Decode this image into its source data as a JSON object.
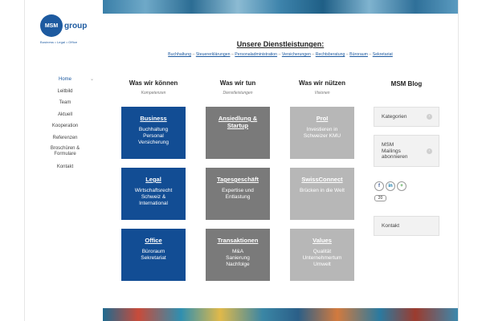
{
  "logo": {
    "mark": "MSM",
    "word": "group",
    "tagline": "Business • Legal • Office"
  },
  "nav": [
    {
      "label": "Home",
      "active": true
    },
    {
      "label": "Leitbild"
    },
    {
      "label": "Team"
    },
    {
      "label": "Aktuell"
    },
    {
      "label": "Kooperation"
    },
    {
      "label": "Referenzen"
    },
    {
      "label": "Broschüren & Formulare"
    },
    {
      "label": "Kontakt"
    }
  ],
  "services": {
    "title": "Unsere Dienstleistungen:",
    "links": [
      "Buchhaltung",
      "Steuererklärungen",
      "Personaladministration",
      "Versicherungen",
      "Rechtsberatung",
      "Büroraum",
      "Sekretariat"
    ],
    "separator": "–"
  },
  "columns": [
    {
      "title": "Was wir können",
      "subtitle": "Kompetenzen",
      "tiles": [
        {
          "title": "Business",
          "text": "Buchhaltung\nPersonal\nVersicherung",
          "style": "blue"
        },
        {
          "title": "Legal",
          "text": "Wirtschaftsrecht\nSchweiz &\nInternational",
          "style": "blue"
        },
        {
          "title": "Office",
          "text": "Büroraum\nSekretariat",
          "style": "blue"
        }
      ]
    },
    {
      "title": "Was wir tun",
      "subtitle": "Dienstleistungen",
      "tiles": [
        {
          "title": "Ansiedlung & Startup",
          "text": "",
          "style": "gray"
        },
        {
          "title": "Tagesgeschäft",
          "text": "Expertise und\nEntlastung",
          "style": "gray"
        },
        {
          "title": "Transaktionen",
          "text": "M&A\nSanierung\nNachfolge",
          "style": "gray"
        }
      ]
    },
    {
      "title": "Was wir nützen",
      "subtitle": "Visionen",
      "tiles": [
        {
          "title": "ProI",
          "text": "Investieren in\nSchweizer KMU",
          "style": "light"
        },
        {
          "title": "SwissConnect",
          "text": "Brücken in die Welt",
          "style": "light"
        },
        {
          "title": "Values",
          "text": "Qualität\nUnternehmertum\nUmwelt",
          "style": "light"
        }
      ]
    }
  ],
  "blog": {
    "title": "MSM Blog",
    "categories": "Kategorien",
    "subscribe": "MSM\nMailings\nabonnieren",
    "share_count": "20",
    "contact": "Kontakt"
  },
  "colors": {
    "brand_blue": "#124d94",
    "tile_gray": "#7a7a7a",
    "tile_light": "#b7b7b7"
  }
}
